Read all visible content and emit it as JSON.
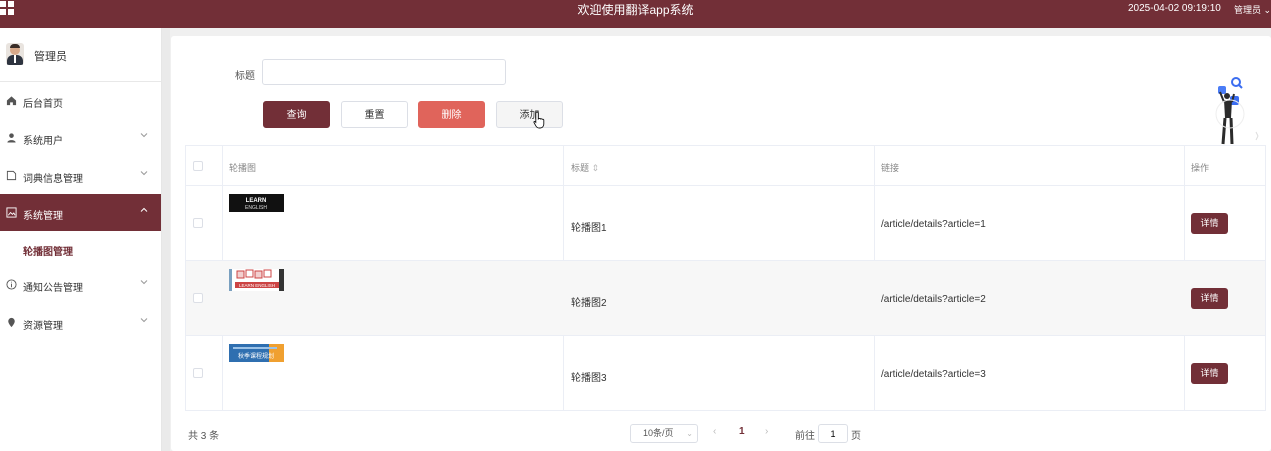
{
  "header": {
    "title": "欢迎使用翻译app系统",
    "datetime": "2025-04-02 09:19:10",
    "user": "管理员"
  },
  "profile": {
    "name": "管理员"
  },
  "sidebar": {
    "items": [
      {
        "label": "后台首页",
        "icon": "home-icon"
      },
      {
        "label": "系统用户",
        "icon": "user-icon"
      },
      {
        "label": "词典信息管理",
        "icon": "document-icon"
      },
      {
        "label": "系统管理",
        "icon": "picture-icon",
        "active": true
      },
      {
        "label": "通知公告管理",
        "icon": "info-icon"
      },
      {
        "label": "资源管理",
        "icon": "location-icon"
      }
    ],
    "sub_item": "轮播图管理"
  },
  "search": {
    "label": "标题",
    "value": "",
    "placeholder": ""
  },
  "buttons": {
    "query": "查询",
    "reset": "重置",
    "delete": "删除",
    "add": "添加"
  },
  "table": {
    "headers": {
      "image": "轮播图",
      "title": "标题",
      "link": "链接",
      "action": "操作"
    },
    "rows": [
      {
        "title": "轮播图1",
        "link": "/article/details?article=1",
        "action": "详情",
        "thumb_text": "LEARN ENGLISH"
      },
      {
        "title": "轮播图2",
        "link": "/article/details?article=2",
        "action": "详情",
        "thumb_text": "LEARN ENGLISH"
      },
      {
        "title": "轮播图3",
        "link": "/article/details?article=3",
        "action": "详情",
        "thumb_text": "秋季课程规划"
      }
    ]
  },
  "pagination": {
    "total": "共 3 条",
    "page_size": "10条/页",
    "prev": "‹",
    "current": "1",
    "next": "›",
    "goto_label": "前往",
    "goto_value": "1",
    "suffix": "页"
  },
  "colors": {
    "brand": "#722f37",
    "danger": "#e0645b"
  }
}
